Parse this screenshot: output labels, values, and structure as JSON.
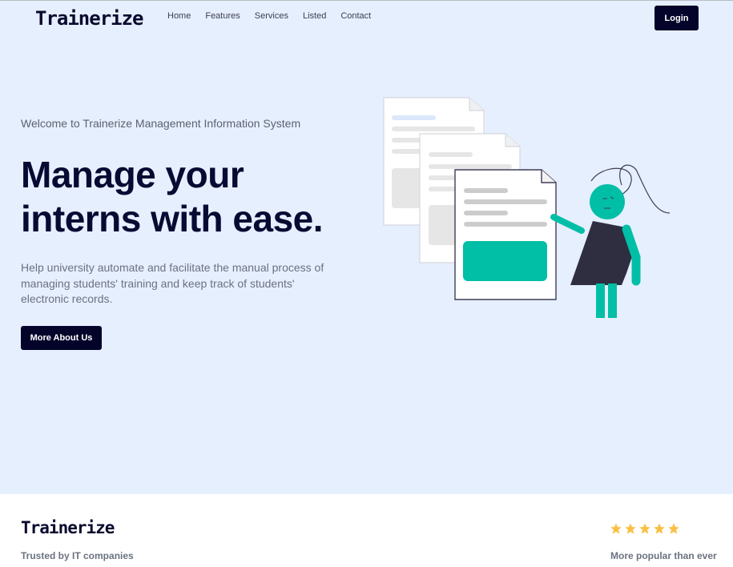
{
  "header": {
    "logo": "Trainerize",
    "nav": [
      "Home",
      "Features",
      "Services",
      "Listed",
      "Contact"
    ],
    "login_label": "Login"
  },
  "hero": {
    "welcome": "Welcome to Trainerize Management Information System",
    "headline_line1": "Manage your",
    "headline_line2": "interns with ease.",
    "description": "Help university automate and facilitate the manual process of managing students' training and keep track of students' electronic records.",
    "cta_label": "More About Us",
    "illustration_icon": "documents-person-illustration"
  },
  "footer_strip": {
    "logo": "Trainerize",
    "trusted_text": "Trusted by IT companies",
    "rating_stars": 5,
    "popular_text": "More popular than ever"
  },
  "colors": {
    "hero_bg": "#e6effe",
    "primary_dark": "#04042a",
    "accent_teal": "#00bfa6",
    "star": "#f8c146"
  }
}
